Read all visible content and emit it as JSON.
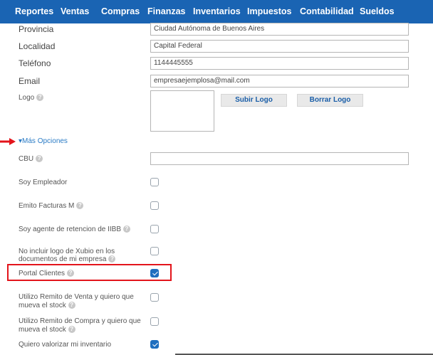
{
  "nav": {
    "items": [
      "Reportes",
      "Ventas",
      "Compras",
      "Finanzas",
      "Inventarios",
      "Impuestos",
      "Contabilidad",
      "Sueldos"
    ]
  },
  "form": {
    "provincia": {
      "label": "Provincia",
      "value": "Ciudad Autónoma de Buenos Aires"
    },
    "localidad": {
      "label": "Localidad",
      "value": "Capital Federal"
    },
    "telefono": {
      "label": "Teléfono",
      "value": "1144445555"
    },
    "email": {
      "label": "Email",
      "value": "empresaejemplosa@mail.com"
    },
    "logo": {
      "label": "Logo",
      "upload_label": "Subir Logo",
      "delete_label": "Borrar Logo"
    }
  },
  "mas_opciones": {
    "label": "▾Más Opciones"
  },
  "options": {
    "cbu": {
      "label": "CBU",
      "value": ""
    },
    "soy_empleador": {
      "label": "Soy Empleador",
      "checked": false
    },
    "emito_facturas_m": {
      "label": "Emito Facturas M",
      "checked": false
    },
    "agente_iibb": {
      "label": "Soy agente de retencion de IIBB",
      "checked": false
    },
    "no_incluir_logo": {
      "label_1": "No incluir logo de Xubio en los",
      "label_2": "documentos de mi empresa",
      "checked": false
    },
    "portal_clientes": {
      "label": "Portal Clientes",
      "checked": true
    },
    "remito_venta": {
      "label_1": "Utilizo Remito de Venta y quiero que",
      "label_2": "mueva el stock",
      "checked": false
    },
    "remito_compra": {
      "label_1": "Utilizo Remito de Compra y quiero que",
      "label_2": "mueva el stock",
      "checked": false
    },
    "valorizar_inventario": {
      "label": "Quiero valorizar mi inventario",
      "checked": true
    }
  },
  "colors": {
    "nav_bg": "#1a64b3",
    "accent": "#1f6fbf",
    "highlight": "#e3141b",
    "link": "#2a7bc5"
  },
  "icons": {
    "help": "question-circle-icon",
    "arrow": "red-arrow-icon"
  }
}
